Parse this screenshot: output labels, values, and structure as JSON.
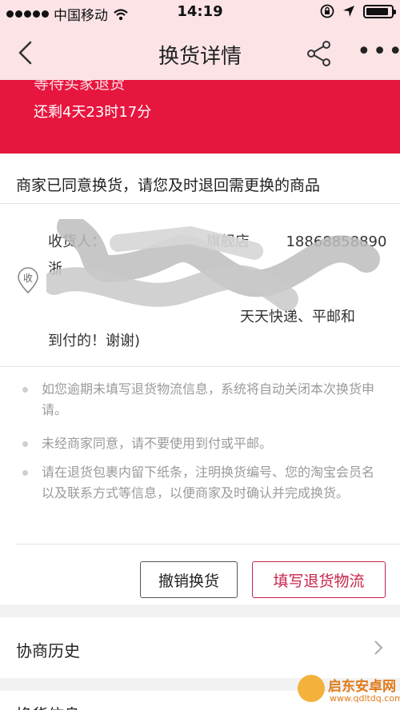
{
  "status_bar": {
    "carrier": "中国移动",
    "time": "14:19",
    "battery_level": 0.9
  },
  "nav": {
    "title": "换货详情",
    "more": "•••"
  },
  "banner": {
    "title": "等待买家退货",
    "countdown": "还剩4天23时17分"
  },
  "notice": "商家已同意换货，请您及时退回需更换的商品",
  "address": {
    "icon_label": "收",
    "line1": "收货人：",
    "shop": "旗舰店",
    "phone": "18868858890",
    "line_obscured": "浙",
    "line3_tail": "天天快递、平邮和",
    "line4": "到付的！谢谢)"
  },
  "tips": [
    "如您逾期未填写退货物流信息，系统将自动关闭本次换货申请。",
    "未经商家同意，请不要使用到付或平邮。",
    "请在退货包裹内留下纸条，注明换货编号、您的淘宝会员名以及联系方式等信息，以便商家及时确认并完成换货。"
  ],
  "buttons": {
    "cancel": "撤销换货",
    "fill_logistics": "填写退货物流"
  },
  "history_label": "协商历史",
  "exchange_info_label": "换货信息",
  "watermark": {
    "name": "启东安卓网",
    "url": "www.qdltdq.com"
  },
  "colors": {
    "brand_red": "#e7163f",
    "nav_pink": "#fbe3e6",
    "button_red": "#c8234a"
  }
}
